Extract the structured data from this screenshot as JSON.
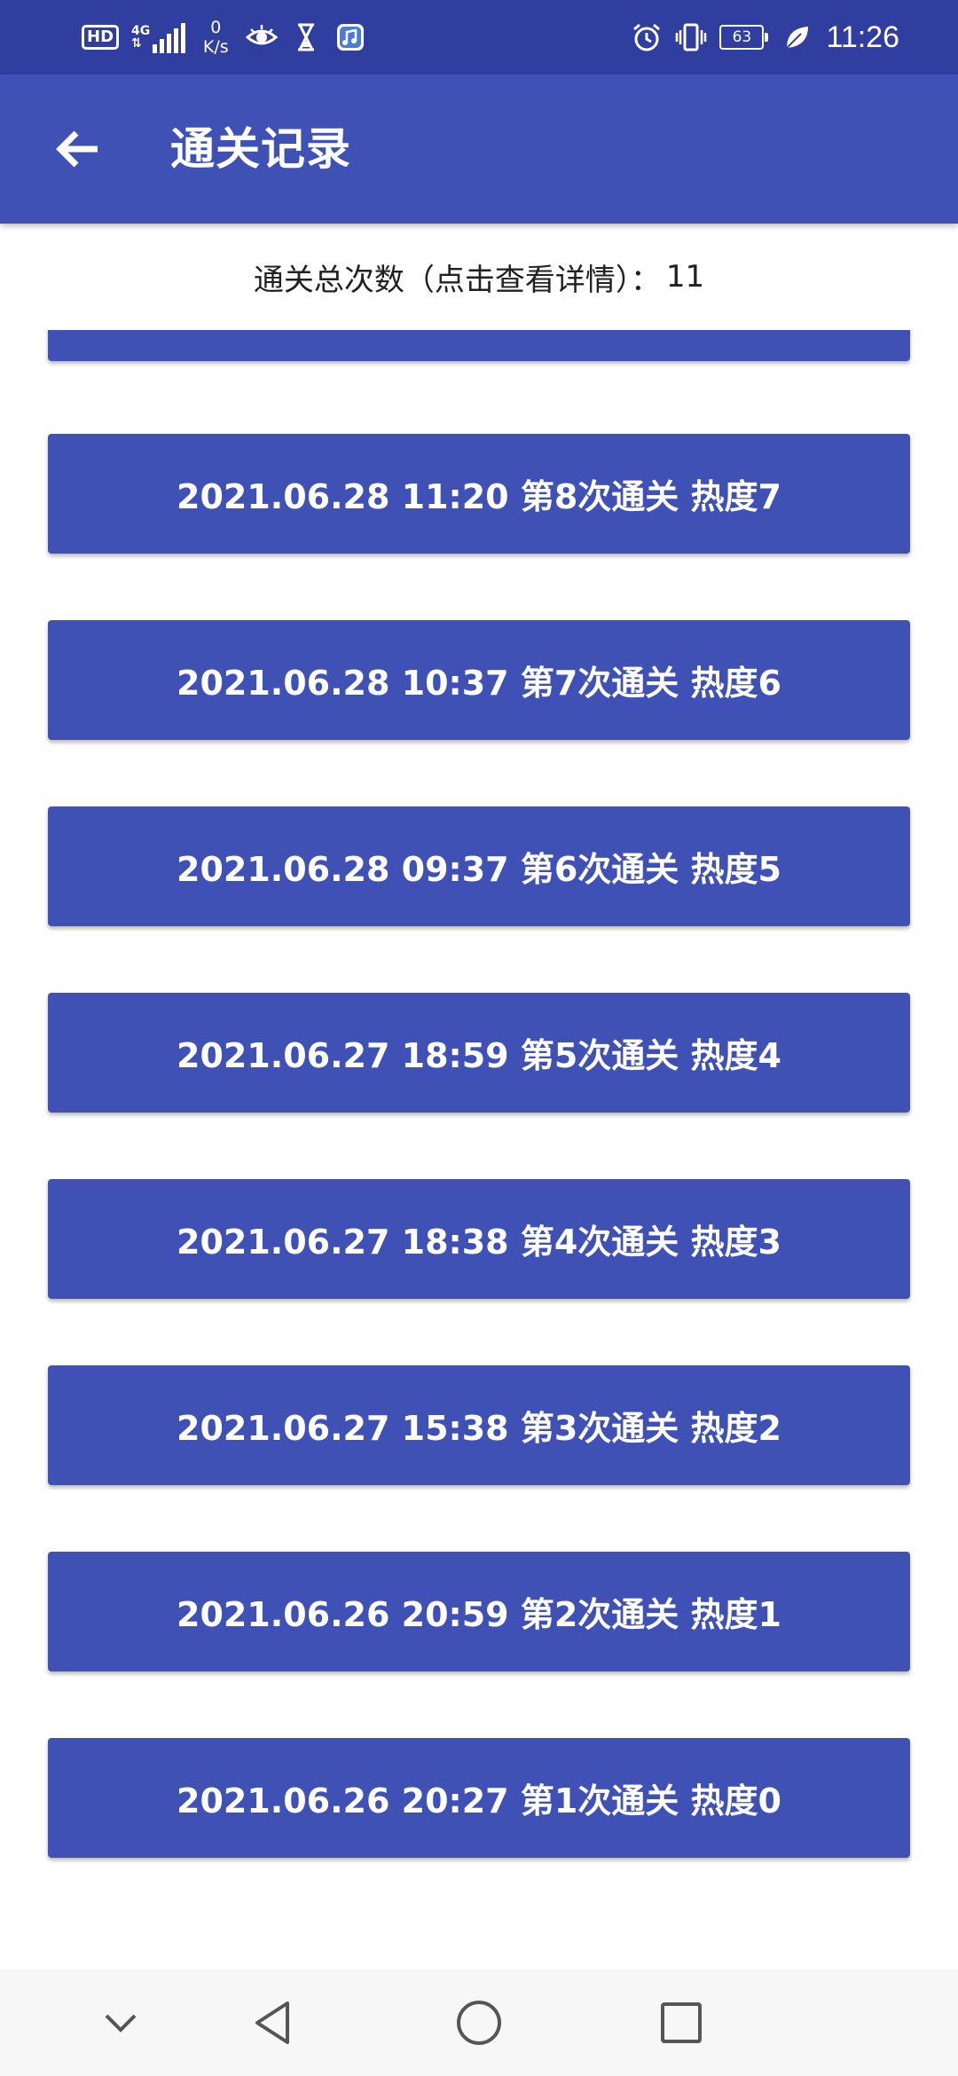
{
  "status_bar": {
    "hd": "HD",
    "network": "4G",
    "speed_value": "0",
    "speed_unit": "K/s",
    "battery": "63",
    "time": "11:26",
    "icons": [
      "hd-icon",
      "signal-icon",
      "eye-icon",
      "hourglass-icon",
      "music-app-icon",
      "alarm-icon",
      "vibrate-icon",
      "battery-icon",
      "leaf-icon"
    ]
  },
  "app_bar": {
    "title": "通关记录",
    "back_icon": "arrow-back-icon",
    "color": "#3f51b5"
  },
  "summary": {
    "label": "通关总次数（点击查看详情）：",
    "count": "11"
  },
  "records": [
    {
      "label": "2021.06.28 11:20 第8次通关 热度7"
    },
    {
      "label": "2021.06.28 10:37 第7次通关 热度6"
    },
    {
      "label": "2021.06.28 09:37 第6次通关 热度5"
    },
    {
      "label": "2021.06.27 18:59 第5次通关 热度4"
    },
    {
      "label": "2021.06.27 18:38 第4次通关 热度3"
    },
    {
      "label": "2021.06.27 15:38 第3次通关 热度2"
    },
    {
      "label": "2021.06.26 20:59 第2次通关 热度1"
    },
    {
      "label": "2021.06.26 20:27 第1次通关 热度0"
    }
  ],
  "nav_bar": {
    "icons": [
      "chevron-down-icon",
      "back-triangle-icon",
      "home-circle-icon",
      "recents-square-icon"
    ]
  },
  "colors": {
    "status_bar": "#303f9f",
    "primary": "#3f51b5",
    "nav_bar": "#f7f7f7"
  }
}
